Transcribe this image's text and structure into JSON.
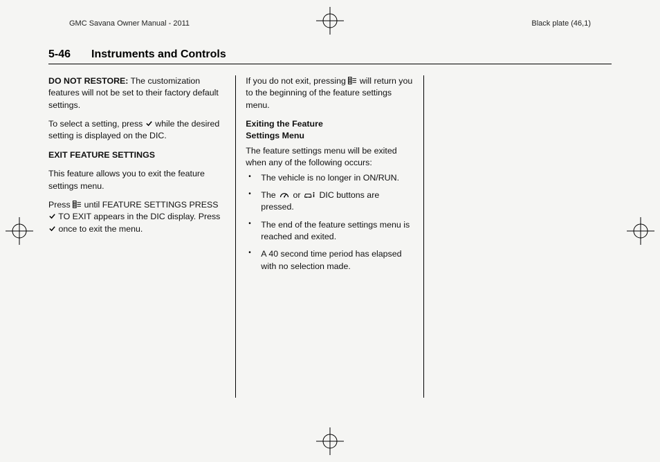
{
  "header": {
    "manual_title": "GMC Savana Owner Manual - 2011",
    "plate": "Black plate (46,1)",
    "page_number": "5-46",
    "section_title": "Instruments and Controls"
  },
  "col1": {
    "p1_label": "DO NOT RESTORE:",
    "p1_body": "  The customization features will not be set to their factory default settings.",
    "p2a": "To select a setting, press ",
    "p2b": " while the desired setting is displayed on the DIC.",
    "sub1": "EXIT FEATURE SETTINGS",
    "p3": "This feature allows you to exit the feature settings menu.",
    "p4a": "Press ",
    "p4b": " until FEATURE SETTINGS PRESS ",
    "p4c": " TO EXIT appears in the DIC display. Press ",
    "p4d": " once to exit the menu."
  },
  "col2": {
    "p1a": "If you do not exit, pressing ",
    "p1b": " will return you to the beginning of the feature settings menu.",
    "sub1a": "Exiting the Feature",
    "sub1b": "Settings Menu",
    "p2": "The feature settings menu will be exited when any of the following occurs:",
    "li1": "The vehicle is no longer in ON/RUN.",
    "li2a": "The ",
    "li2b": " or ",
    "li2c": " DIC buttons are pressed.",
    "li3": "The end of the feature settings menu is reached and exited.",
    "li4": "A 40 second time period has elapsed with no selection made."
  },
  "icons": {
    "check_name": "checkmark-icon",
    "customize_name": "customize-icon",
    "trip_name": "trip-odometer-icon",
    "vehicle_info_name": "vehicle-info-icon"
  }
}
